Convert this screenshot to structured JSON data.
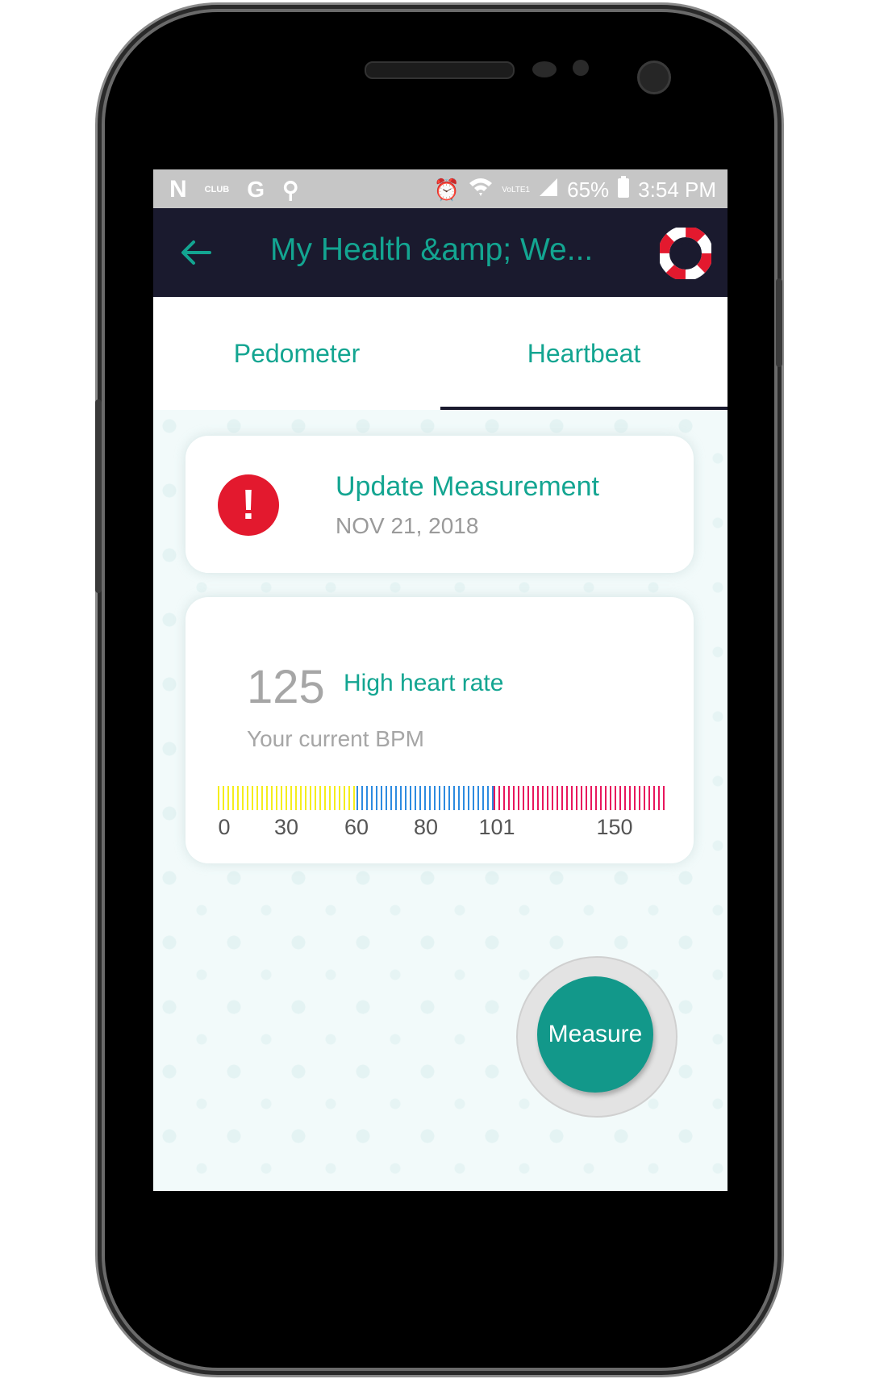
{
  "status_bar": {
    "battery": "65%",
    "time": "3:54 PM",
    "network": "VoLTE1",
    "club_text": "CLUB"
  },
  "app_bar": {
    "title": "My Health &amp; We..."
  },
  "tabs": [
    {
      "label": "Pedometer",
      "selected": false
    },
    {
      "label": "Heartbeat",
      "selected": true
    }
  ],
  "update_card": {
    "title": "Update Measurement",
    "date": "NOV 21, 2018"
  },
  "heart_card": {
    "bpm": "125",
    "status": "High heart rate",
    "label": "Your current BPM",
    "scale_ticks": [
      "0",
      "30",
      "60",
      "80",
      "101",
      "150"
    ]
  },
  "measure_button": {
    "label": "Measure"
  },
  "colors": {
    "accent": "#13a591",
    "appbar": "#1a1a2e",
    "alert": "#e3192e",
    "scale_low": "#f5ee1c",
    "scale_mid": "#2d8be0",
    "scale_high": "#e8175d"
  }
}
